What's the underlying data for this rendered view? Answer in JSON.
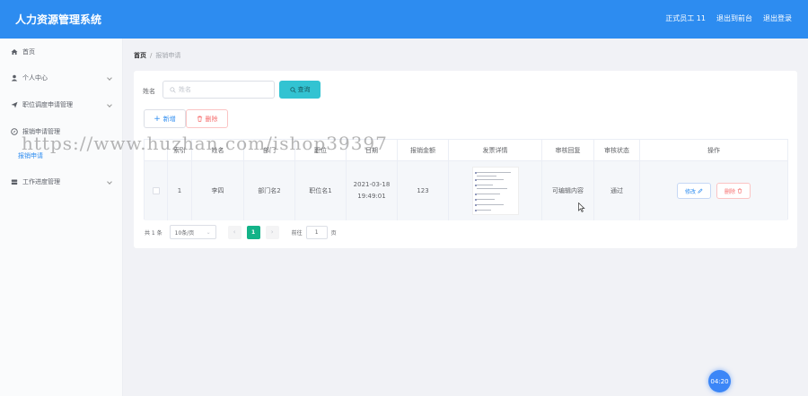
{
  "header": {
    "title": "人力资源管理系统",
    "user_label": "正式员工 11",
    "back_label": "退出到前台",
    "logout_label": "退出登录"
  },
  "sidebar": {
    "items": [
      {
        "label": "首页",
        "icon": "home-icon"
      },
      {
        "label": "个人中心",
        "icon": "user-icon"
      },
      {
        "label": "职位调度申请管理",
        "icon": "send-icon"
      },
      {
        "label": "报销申请管理",
        "icon": "compass-icon"
      },
      {
        "label": "工作进度管理",
        "icon": "drive-icon"
      }
    ],
    "subitem": "报销申请"
  },
  "breadcrumb": {
    "home": "首页",
    "separator": "/",
    "current": "报销申请"
  },
  "search": {
    "label": "姓名",
    "placeholder": "姓名",
    "button": "查询"
  },
  "actions": {
    "add": "新增",
    "delete": "删除"
  },
  "table": {
    "headers": [
      "",
      "索引",
      "姓名",
      "部门",
      "职位",
      "日期",
      "报销金额",
      "发票详情",
      "审核回复",
      "审核状态",
      "操作"
    ],
    "rows": [
      {
        "index": "1",
        "name": "李四",
        "department": "部门名2",
        "position": "职位名1",
        "date_line1": "2021-03-18",
        "date_line2": "19:49:01",
        "amount": "123",
        "reply": "可编辑内容",
        "status": "通过",
        "edit": "修改",
        "remove": "删除"
      }
    ]
  },
  "pagination": {
    "total": "共 1 条",
    "page_size": "10条/页",
    "current_page": "1",
    "goto_label": "前往",
    "goto_value": "1",
    "page_unit": "页"
  },
  "watermark": "https://www.huzhan.com/ishop39397",
  "timer": "04:20",
  "colors": {
    "header": "#2d8cf0",
    "query_button": "#32c3d2",
    "active_page": "#13b388",
    "danger": "#f56c6c"
  }
}
